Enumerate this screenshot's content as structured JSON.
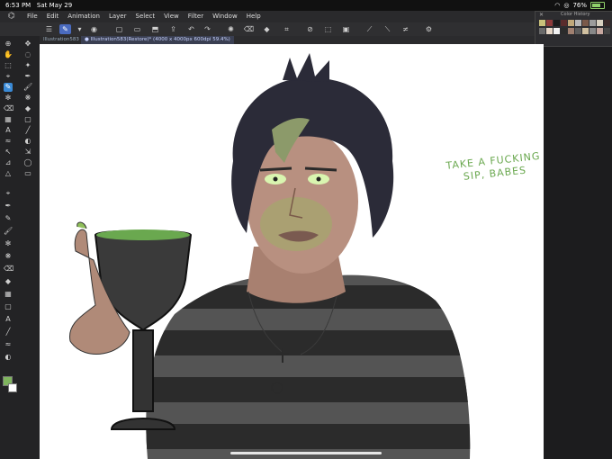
{
  "status": {
    "time": "6:53 PM",
    "date": "Sat May 29",
    "battery_pct": "76%",
    "battery_level": 0.76,
    "colors": {
      "battery": "#8fd16a"
    }
  },
  "menu": {
    "items": [
      "File",
      "Edit",
      "Animation",
      "Layer",
      "Select",
      "View",
      "Filter",
      "Window",
      "Help"
    ]
  },
  "tabs": [
    {
      "label": "Illustration583"
    },
    {
      "label": "● Illustration583(Restore)* (4000 x 4000px 600dpi 59.4%)"
    }
  ],
  "color_history": {
    "title": "Color History",
    "swatches": [
      "#c9c07a",
      "#8d3a3a",
      "#1b1b1b",
      "#5a2c2c",
      "#c0a87a",
      "#b7b7b7",
      "#7a5a4a",
      "#9c9c9c",
      "#d8d0c0",
      "#3a2a2a",
      "#6a6a6a",
      "#e8d8c8",
      "#f2f2f2",
      "#2b2b2b",
      "#a08070",
      "#5c5c5c",
      "#d0c0a0",
      "#888888",
      "#c8a8a0",
      "#444444"
    ]
  },
  "canvas": {
    "caption_line1": "TAKE A FUCKING",
    "caption_line2": "SIP, BABES",
    "colors": {
      "caption": "#6aa84f",
      "skin": "#b08a78",
      "hair": "#2b2b38",
      "stripe_dark": "#2b2b2b",
      "stripe_light": "#545454",
      "green": "#8fbf5a"
    }
  },
  "tools": {
    "primary_color": "#7fb55e",
    "secondary_color": "#ffffff"
  }
}
